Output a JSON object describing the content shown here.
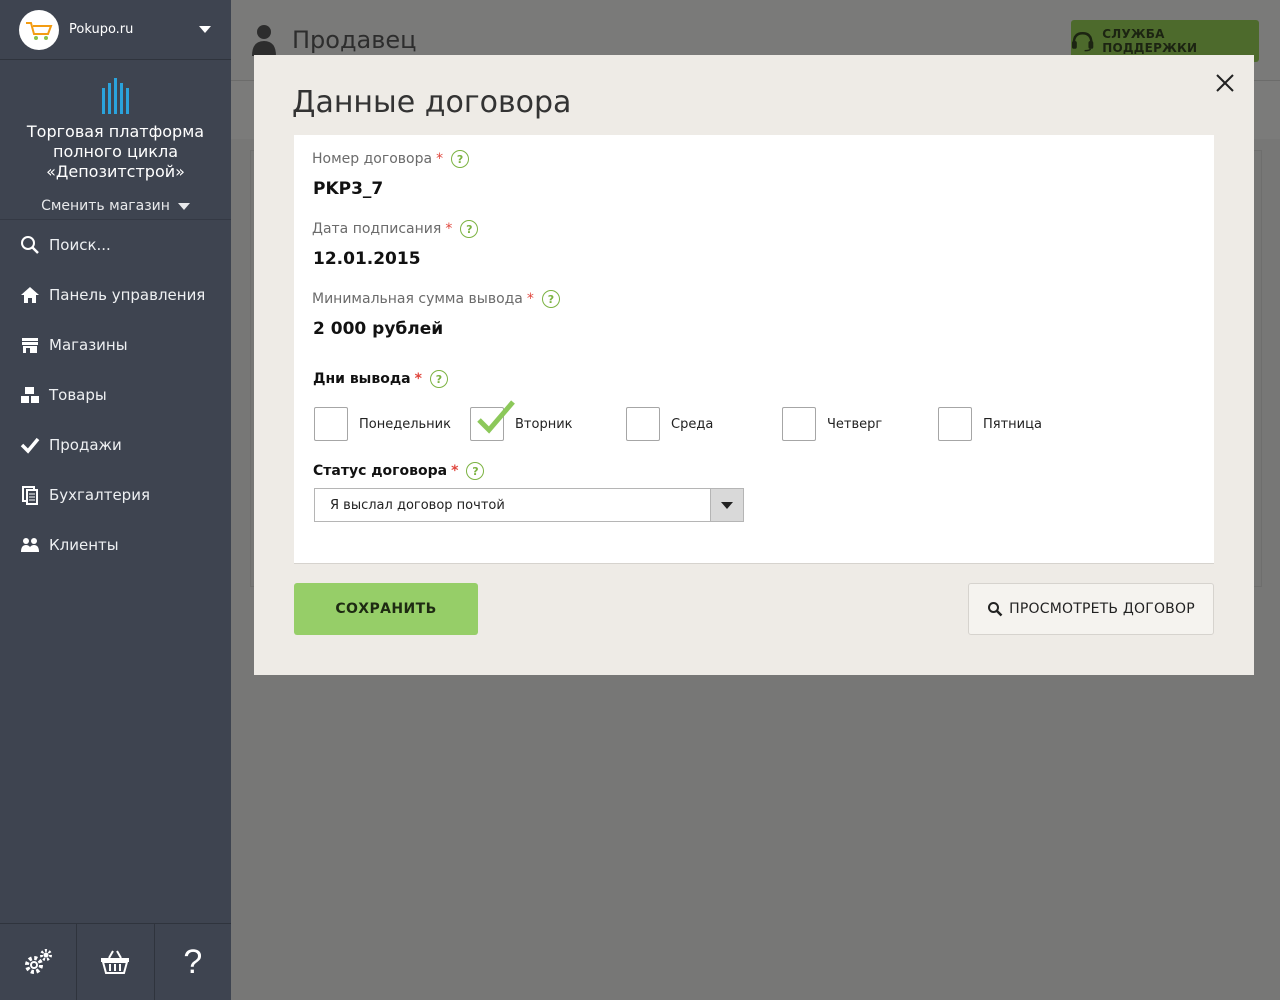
{
  "sidebar": {
    "store_name": "Pokupo.ru",
    "brand_title": "Торговая платформа полного цикла «Депозитстрой»",
    "switch_store_label": "Сменить магазин",
    "items": [
      {
        "label": "Поиск...",
        "icon": "search-icon"
      },
      {
        "label": "Панель управления",
        "icon": "home-icon"
      },
      {
        "label": "Магазины",
        "icon": "store-icon"
      },
      {
        "label": "Товары",
        "icon": "boxes-icon"
      },
      {
        "label": "Продажи",
        "icon": "check-icon"
      },
      {
        "label": "Бухгалтерия",
        "icon": "documents-icon"
      },
      {
        "label": "Клиенты",
        "icon": "users-icon"
      }
    ],
    "bottom": {
      "settings_icon": "gears-icon",
      "cart_icon": "basket-icon",
      "help_label": "?"
    }
  },
  "header": {
    "page_title": "Продавец",
    "support_label": "СЛУЖБА ПОДДЕРЖКИ"
  },
  "modal": {
    "title": "Данные договора",
    "contract_number": {
      "label": "Номер договора",
      "value": "PKP3_7"
    },
    "sign_date": {
      "label": "Дата подписания",
      "value": "12.01.2015"
    },
    "min_withdrawal": {
      "label": "Минимальная сумма вывода",
      "value": "2 000 рублей"
    },
    "withdraw_days": {
      "label": "Дни вывода",
      "days": [
        {
          "label": "Понедельник",
          "checked": false
        },
        {
          "label": "Вторник",
          "checked": true
        },
        {
          "label": "Среда",
          "checked": false
        },
        {
          "label": "Четверг",
          "checked": false
        },
        {
          "label": "Пятница",
          "checked": false
        }
      ]
    },
    "contract_status": {
      "label": "Статус договора",
      "value": "Я выслал договор почтой"
    },
    "required_mark": "*",
    "help_mark": "?",
    "save_label": "СОХРАНИТЬ",
    "view_label": "ПРОСМОТРЕТЬ ДОГОВОР"
  },
  "colors": {
    "accent": "#96ce68",
    "sidebar_bg": "#3e4450",
    "help": "#7cb342",
    "required": "#e0463d"
  }
}
